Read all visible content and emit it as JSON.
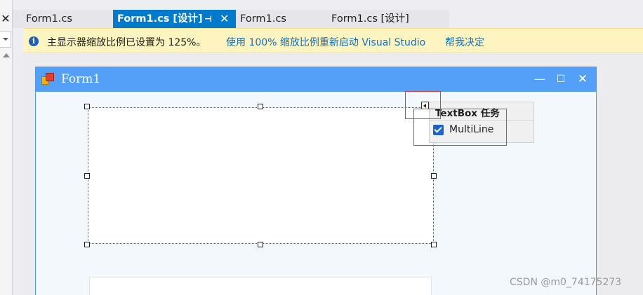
{
  "gutter": {
    "close_glyph": "✕",
    "icons": [
      "close-icon",
      "chevron-down-icon",
      "scroll-up-icon"
    ]
  },
  "tabs": [
    {
      "label": "Form1.cs",
      "active": false
    },
    {
      "label": "Form1.cs [设计]",
      "active": true,
      "pin_glyph": "⊣",
      "close_glyph": "✕"
    },
    {
      "label": "Form1.cs",
      "active": false
    },
    {
      "label": "Form1.cs [设计]",
      "active": false
    }
  ],
  "infobar": {
    "icon": "info-icon",
    "icon_glyph": "i",
    "message": "主显示器缩放比例已设置为 125%。",
    "link_restart": "使用 100% 缩放比例重新启动 Visual Studio",
    "link_decide": "帮我决定"
  },
  "form": {
    "title": "Form1",
    "min_glyph": "—",
    "max_glyph": "☐",
    "close_glyph": "✕"
  },
  "task_panel": {
    "title": "TextBox 任务",
    "multiline_label": "MultiLine",
    "multiline_checked": true
  },
  "watermark": "CSDN @m0_74175273",
  "colors": {
    "accent": "#007acc",
    "form_titlebar": "#54a0f8",
    "infobar_bg": "#fdf4bf",
    "link": "#0e70c0",
    "annotation_red": "#e03a3a"
  }
}
